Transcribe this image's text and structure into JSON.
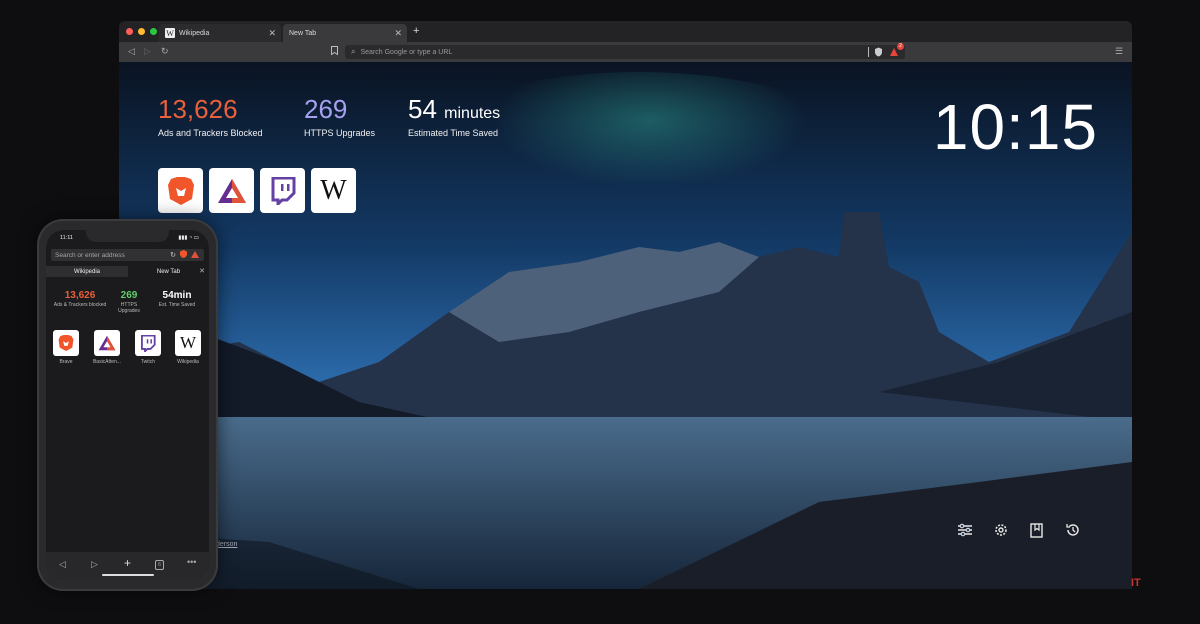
{
  "browser": {
    "tabs": [
      {
        "label": "Wikipedia",
        "favicon": "W"
      },
      {
        "label": "New Tab"
      }
    ],
    "url_placeholder": "Search Google or type a URL",
    "shield_badge": "2"
  },
  "stats": {
    "ads": {
      "value": "13,626",
      "label": "Ads and Trackers Blocked",
      "color": "#e8603c"
    },
    "https": {
      "value": "269",
      "label": "HTTPS Upgrades",
      "color": "#a5a0ef"
    },
    "time": {
      "value": "54",
      "unit": "minutes",
      "label": "Estimated Time Saved"
    }
  },
  "clock": "10:15",
  "top_sites": [
    {
      "name": "Brave",
      "icon": "brave-lion-icon"
    },
    {
      "name": "BasicAtten...",
      "icon": "bat-triangle-icon"
    },
    {
      "name": "Twitch",
      "icon": "twitch-icon"
    },
    {
      "name": "Wikipedia",
      "icon": "wikipedia-w-icon",
      "glyph": "W"
    }
  ],
  "photo_credit": "derson",
  "phone": {
    "time": "11:11",
    "address_placeholder": "Search or enter address",
    "tabs": [
      "Wikipedia",
      "New Tab"
    ],
    "stats": [
      {
        "value": "13,626",
        "label": "Ads & Trackers blocked",
        "color": "#e8603c"
      },
      {
        "value": "269",
        "label": "HTTPS Upgrades",
        "color": "#5fcf6a"
      },
      {
        "value": "54min",
        "label": "Est. Time Saved",
        "color": "#ffffff"
      }
    ],
    "sites": [
      "Brave",
      "BasicAtten...",
      "Twitch",
      "Wikipedia"
    ]
  },
  "watermark": "IT"
}
